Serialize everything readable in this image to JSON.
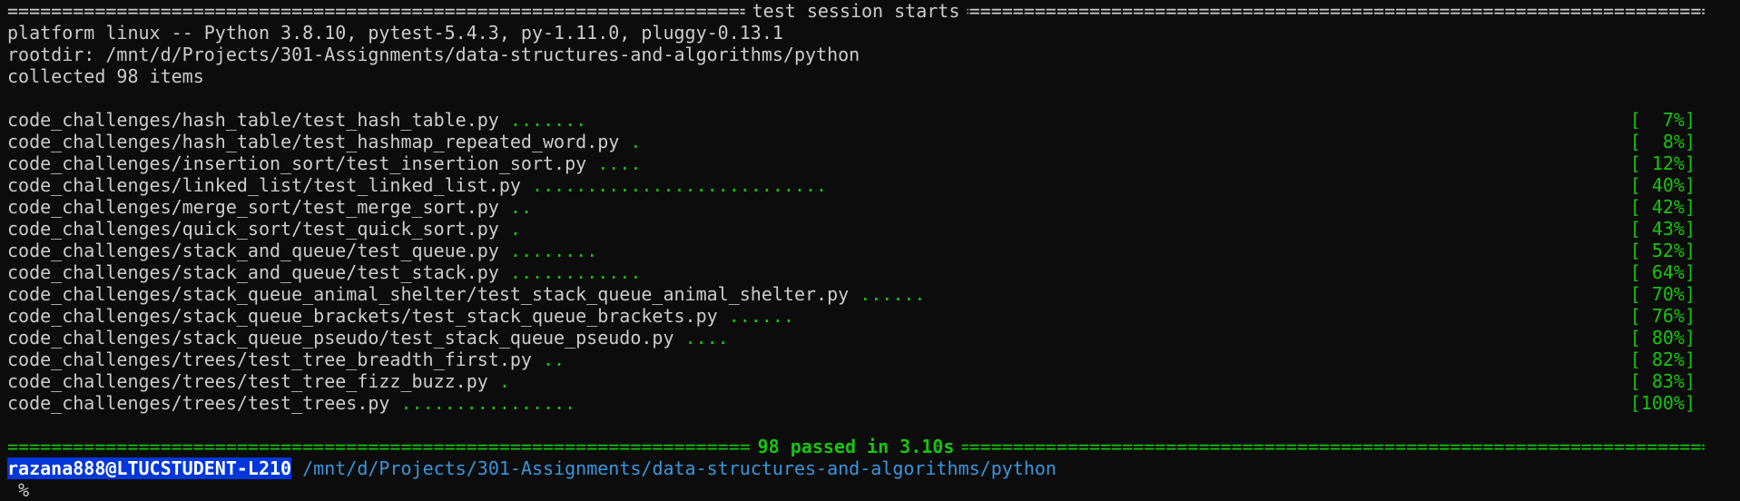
{
  "header": {
    "session_title": "test session starts"
  },
  "info": {
    "platform": "platform linux -- Python 3.8.10, pytest-5.4.3, py-1.11.0, pluggy-0.13.1",
    "rootdir": "rootdir: /mnt/d/Projects/301-Assignments/data-structures-and-algorithms/python",
    "collected": "collected 98 items"
  },
  "tests": [
    {
      "file": "code_challenges/hash_table/test_hash_table.py",
      "dots": ".......",
      "pct": "[  7%]"
    },
    {
      "file": "code_challenges/hash_table/test_hashmap_repeated_word.py",
      "dots": ".",
      "pct": "[  8%]"
    },
    {
      "file": "code_challenges/insertion_sort/test_insertion_sort.py",
      "dots": "....",
      "pct": "[ 12%]"
    },
    {
      "file": "code_challenges/linked_list/test_linked_list.py",
      "dots": "...........................",
      "pct": "[ 40%]"
    },
    {
      "file": "code_challenges/merge_sort/test_merge_sort.py",
      "dots": "..",
      "pct": "[ 42%]"
    },
    {
      "file": "code_challenges/quick_sort/test_quick_sort.py",
      "dots": ".",
      "pct": "[ 43%]"
    },
    {
      "file": "code_challenges/stack_and_queue/test_queue.py",
      "dots": "........",
      "pct": "[ 52%]"
    },
    {
      "file": "code_challenges/stack_and_queue/test_stack.py",
      "dots": "............",
      "pct": "[ 64%]"
    },
    {
      "file": "code_challenges/stack_queue_animal_shelter/test_stack_queue_animal_shelter.py",
      "dots": "......",
      "pct": "[ 70%]"
    },
    {
      "file": "code_challenges/stack_queue_brackets/test_stack_queue_brackets.py",
      "dots": "......",
      "pct": "[ 76%]"
    },
    {
      "file": "code_challenges/stack_queue_pseudo/test_stack_queue_pseudo.py",
      "dots": "....",
      "pct": "[ 80%]"
    },
    {
      "file": "code_challenges/trees/test_tree_breadth_first.py",
      "dots": "..",
      "pct": "[ 82%]"
    },
    {
      "file": "code_challenges/trees/test_tree_fizz_buzz.py",
      "dots": ".",
      "pct": "[ 83%]"
    },
    {
      "file": "code_challenges/trees/test_trees.py",
      "dots": "................",
      "pct": "[100%]"
    }
  ],
  "summary": {
    "text": "98 passed in 3.10s"
  },
  "prompt": {
    "user_host": "razana888@LTUCSTUDENT-L210",
    "path": "/mnt/d/Projects/301-Assignments/data-structures-and-algorithms/python",
    "symbol": "%"
  },
  "colors": {
    "background": "#0c0c0c",
    "text": "#cccccc",
    "pass_green": "#16c60c",
    "prompt_highlight": "#0037da",
    "path_blue": "#3a96dd"
  }
}
